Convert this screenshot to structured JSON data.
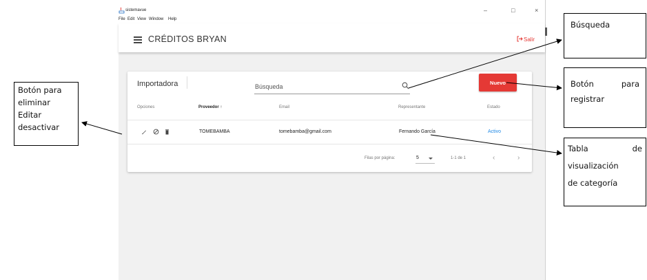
{
  "window": {
    "title": "sistemavue",
    "minimize_glyph": "–",
    "maximize_glyph": "□",
    "close_glyph": "×"
  },
  "menubar": {
    "items": [
      "File",
      "Edit",
      "View",
      "Window",
      "Help"
    ]
  },
  "appbar": {
    "title": "CRÉDITOS BRYAN",
    "logout_label": "Salir"
  },
  "card": {
    "title": "Importadora",
    "search_placeholder": "Búsqueda",
    "new_button_label": "Nuevo"
  },
  "table": {
    "headers": [
      "Opciones",
      "Proveedor ↑",
      "Email",
      "Representante",
      "Estado"
    ],
    "rows": [
      {
        "actions": [
          "edit-icon",
          "block-icon",
          "delete-icon"
        ],
        "proveedor": "TOMEBAMBA",
        "email": "tomebamba@gmail.com",
        "representante": "Fernando García",
        "estado": "Activo"
      }
    ]
  },
  "pagination": {
    "rows_per_page_label": "Filas por página:",
    "rows_per_page_value": "5",
    "range_label": "1-1 de 1",
    "prev_glyph": "‹",
    "next_glyph": "›"
  },
  "annotations": {
    "left_lines": [
      "Botón para",
      "eliminar",
      "Editar",
      "desactivar"
    ],
    "busqueda": "Búsqueda",
    "registrar_line1_a": "Botón",
    "registrar_line1_b": "para",
    "registrar_line2": "registrar",
    "tabla_line1_a": "Tabla",
    "tabla_line1_b": "de",
    "tabla_line2": "visualización",
    "tabla_line3": "de categoría"
  },
  "colors": {
    "accent_red": "#e53935",
    "status_blue": "#1e88e5",
    "window_bg": "#f1f1f1"
  }
}
